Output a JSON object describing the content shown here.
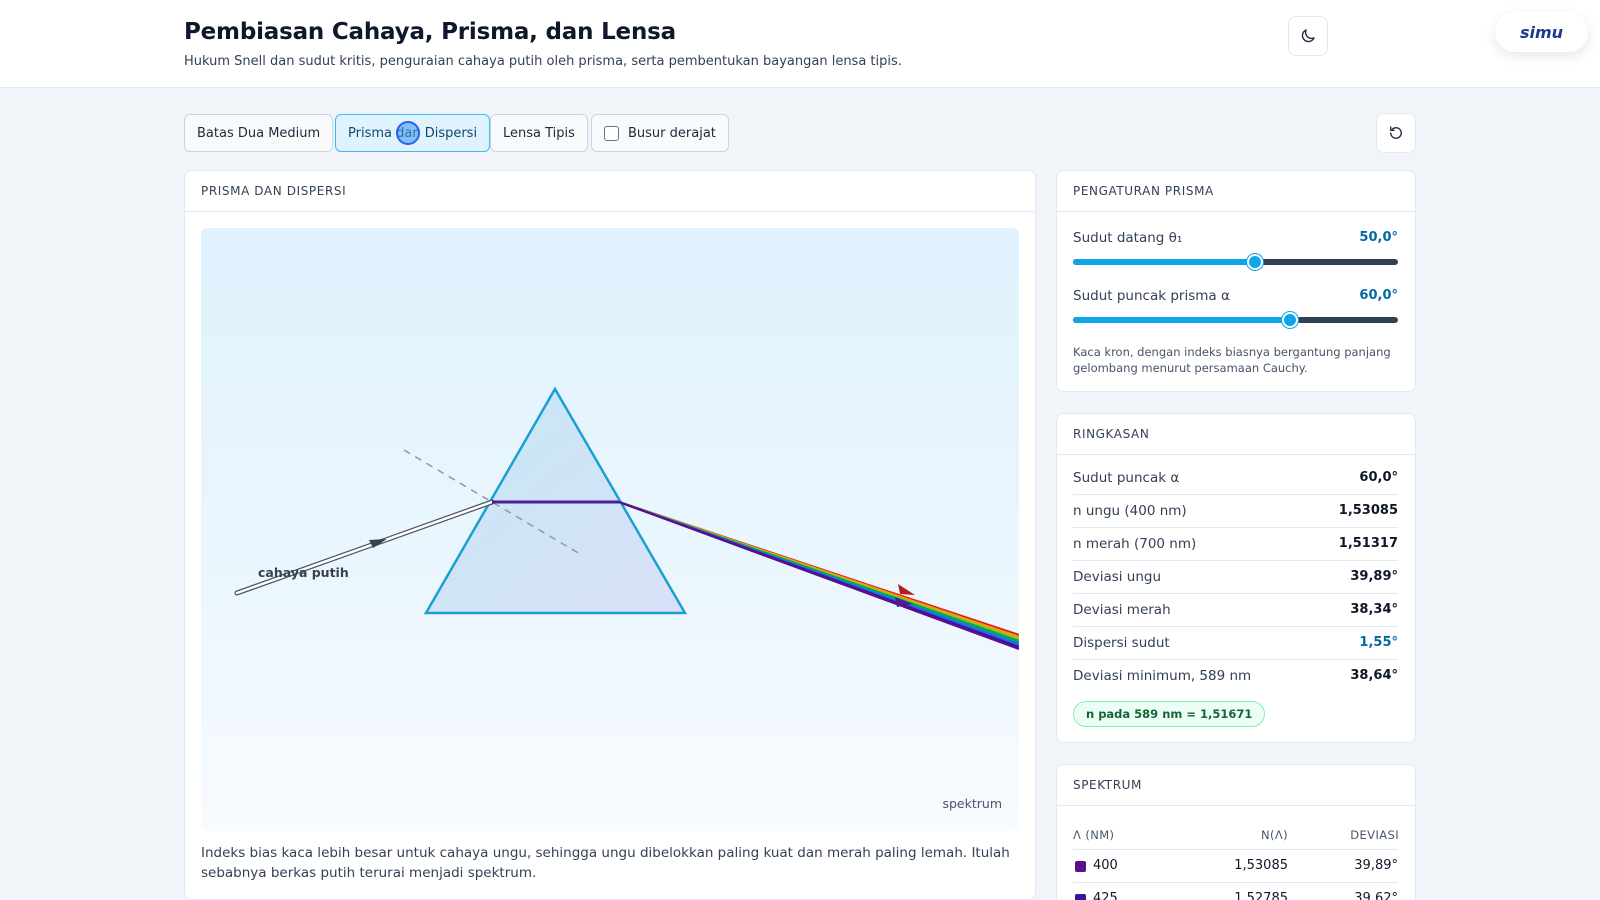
{
  "header": {
    "title": "Pembiasan Cahaya, Prisma, dan Lensa",
    "subtitle": "Hukum Snell dan sudut kritis, penguraian cahaya putih oleh prisma, serta pembentukan bayangan lensa tipis.",
    "theme_icon": "moon-icon",
    "brand": "simu"
  },
  "toolbar": {
    "tabs": [
      {
        "label": "Batas Dua Medium",
        "active": false
      },
      {
        "label": "Prisma dan Dispersi",
        "active": true
      },
      {
        "label": "Lensa Tipis",
        "active": false
      }
    ],
    "protractor_label": "Busur derajat",
    "protractor_checked": false,
    "reset_icon": "reset-icon"
  },
  "sim": {
    "panel_title": "PRISMA DAN DISPERSI",
    "ray_label": "cahaya putih",
    "spectrum_label": "spektrum",
    "caption": "Indeks bias kaca lebih besar untuk cahaya ungu, sehingga ungu dibelokkan paling kuat dan merah paling lemah. Itulah sebabnya berkas putih terurai menjadi spektrum."
  },
  "settings": {
    "panel_title": "PENGATURAN PRISMA",
    "sliders": [
      {
        "label": "Sudut datang θ₁",
        "value": "50,0°",
        "fraction": 0.56
      },
      {
        "label": "Sudut puncak prisma α",
        "value": "60,0°",
        "fraction": 0.667
      }
    ],
    "note": "Kaca kron, dengan indeks biasnya bergantung panjang gelombang menurut persamaan Cauchy."
  },
  "summary": {
    "panel_title": "RINGKASAN",
    "rows": [
      {
        "label": "Sudut puncak α",
        "value": "60,0°",
        "accent": false
      },
      {
        "label": "n ungu (400 nm)",
        "value": "1,53085",
        "accent": false
      },
      {
        "label": "n merah (700 nm)",
        "value": "1,51317",
        "accent": false
      },
      {
        "label": "Deviasi ungu",
        "value": "39,89°",
        "accent": false
      },
      {
        "label": "Deviasi merah",
        "value": "38,34°",
        "accent": false
      },
      {
        "label": "Dispersi sudut",
        "value": "1,55°",
        "accent": true
      },
      {
        "label": "Deviasi minimum, 589 nm",
        "value": "38,64°",
        "accent": false
      }
    ],
    "badge": "n pada 589 nm = 1,51671"
  },
  "spectrum": {
    "panel_title": "SPEKTRUM",
    "headers": [
      "Λ (NM)",
      "N(Λ)",
      "DEVIASI"
    ],
    "rows": [
      {
        "lambda": "400",
        "n": "1,53085",
        "dev": "39,89°",
        "color": "#5b0f8a"
      },
      {
        "lambda": "425",
        "n": "1,52785",
        "dev": "39,62°",
        "color": "#3a14a0"
      }
    ]
  },
  "colors": {
    "accent": "#0ea5e9",
    "active_tab": "#e0f2fe",
    "value_accent": "#0369a1",
    "badge_green": "#166534"
  }
}
